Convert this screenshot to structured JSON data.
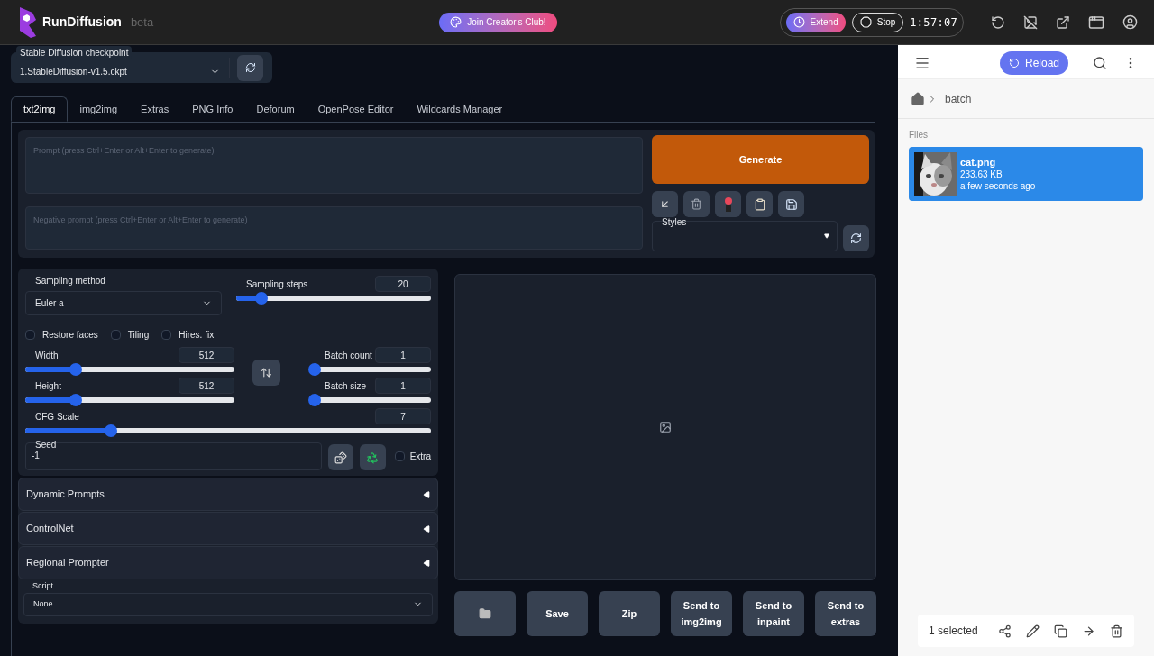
{
  "header": {
    "brand": "RunDiffusion",
    "badge": "beta",
    "club_button": "Join Creator's Club!",
    "extend_button": "Extend",
    "stop_button": "Stop",
    "timer": "1:57:07"
  },
  "checkpoint": {
    "label": "Stable Diffusion checkpoint",
    "value": "1.StableDiffusion-v1.5.ckpt"
  },
  "tabs": [
    {
      "label": "txt2img",
      "selected": true
    },
    {
      "label": "img2img",
      "selected": false
    },
    {
      "label": "Extras",
      "selected": false
    },
    {
      "label": "PNG Info",
      "selected": false
    },
    {
      "label": "Deforum",
      "selected": false
    },
    {
      "label": "OpenPose Editor",
      "selected": false
    },
    {
      "label": "Wildcards Manager",
      "selected": false
    }
  ],
  "prompt": {
    "placeholder": "Prompt (press Ctrl+Enter or Alt+Enter to generate)"
  },
  "negative_prompt": {
    "placeholder": "Negative prompt (press Ctrl+Enter or Alt+Enter to generate)"
  },
  "generate_button": "Generate",
  "styles": {
    "label": "Styles"
  },
  "sampling_method": {
    "label": "Sampling method",
    "value": "Euler a"
  },
  "sampling_steps": {
    "label": "Sampling steps",
    "value": "20",
    "level": 0.13
  },
  "checkboxes": [
    {
      "label": "Restore faces",
      "checked": false
    },
    {
      "label": "Tiling",
      "checked": false
    },
    {
      "label": "Hires. fix",
      "checked": false
    }
  ],
  "width": {
    "label": "Width",
    "value": "512",
    "level": 0.24
  },
  "height": {
    "label": "Height",
    "value": "512",
    "level": 0.24
  },
  "batch_count": {
    "label": "Batch count",
    "value": "1",
    "level": 0
  },
  "batch_size": {
    "label": "Batch size",
    "value": "1",
    "level": 0
  },
  "cfg_scale": {
    "label": "CFG Scale",
    "value": "7",
    "level": 0.21
  },
  "seed": {
    "label": "Seed",
    "value": "-1",
    "extra_label": "Extra",
    "extra_checked": false
  },
  "accordions": [
    "Dynamic Prompts",
    "ControlNet",
    "Regional Prompter"
  ],
  "script": {
    "label": "Script",
    "value": "None"
  },
  "output_buttons": [
    "Save",
    "Zip",
    "Send to img2img",
    "Send to inpaint",
    "Send to extras"
  ],
  "file_panel": {
    "reload_button": "Reload",
    "breadcrumb": "batch",
    "section": "Files",
    "files": [
      {
        "name": "cat.png",
        "size": "233.63 KB",
        "time": "a few seconds ago",
        "selected": true
      }
    ],
    "selection_count": "1 selected"
  }
}
